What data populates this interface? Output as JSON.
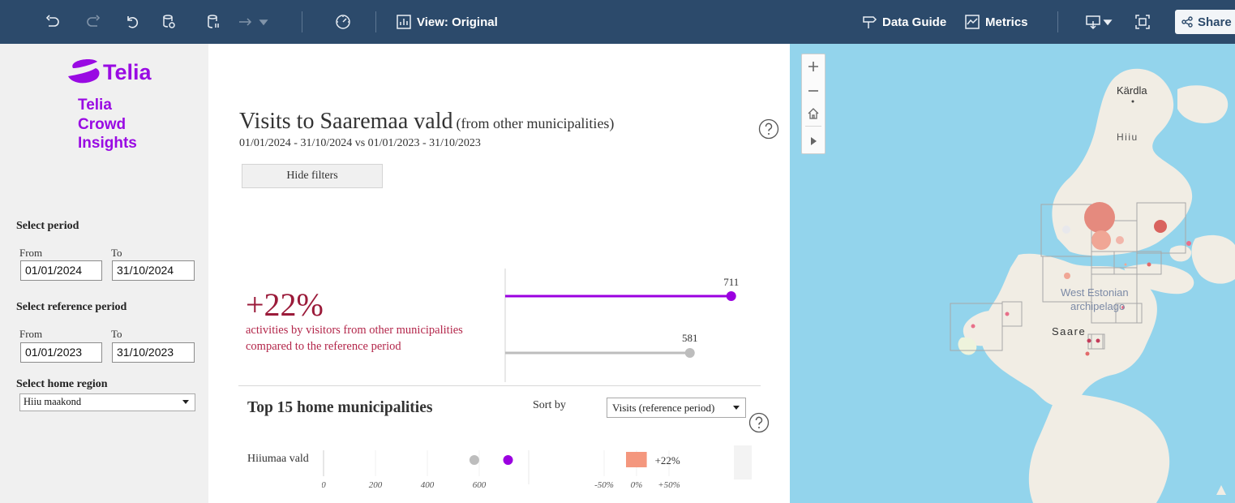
{
  "toolbar": {
    "view_label": "View: Original",
    "data_guide_label": "Data Guide",
    "metrics_label": "Metrics",
    "share_label": "Share"
  },
  "brand": {
    "name": "Telia",
    "subtitle_lines": [
      "Telia",
      "Crowd",
      "Insights"
    ],
    "color": "#990ae3"
  },
  "filters": {
    "period_heading": "Select period",
    "from_label": "From",
    "to_label": "To",
    "period_from": "01/01/2024",
    "period_to": "31/10/2024",
    "reference_heading": "Select reference period",
    "reference_from": "01/01/2023",
    "reference_to": "31/10/2023",
    "home_region_heading": "Select home region",
    "home_region_value": "Hiiu maakond"
  },
  "header": {
    "title": "Visits to Saaremaa vald",
    "title_suffix": "(from other municipalities)",
    "date_range": "01/01/2024 - 31/10/2024 vs  01/01/2023 - 31/10/2023",
    "hide_filters_label": "Hide filters"
  },
  "kpi": {
    "change_pct": "+22%",
    "description": "activities by visitors from other municipalities compared to the reference period",
    "current_value": 711,
    "reference_value": 581,
    "current_color": "#9b00e0",
    "reference_color": "#bdbdbd",
    "scale_max": 750
  },
  "top_municipalities": {
    "heading": "Top 15 home municipalities",
    "sort_label": "Sort by",
    "sort_value": "Visits (reference period)",
    "rows": [
      {
        "name": "Hiiumaa vald",
        "reference": 581,
        "current": 711,
        "change_label": "+22%",
        "change_pct": 22
      }
    ],
    "visits_ticks": [
      "0",
      "200",
      "400",
      "600"
    ],
    "visits_max": 800,
    "change_ticks": [
      "-50%",
      "0%",
      "+50%"
    ],
    "change_color": "#f4977e"
  },
  "map": {
    "labels": {
      "kardla": "Kärdla",
      "hiiu": "Hiiu",
      "archipelago_line1": "West Estonian",
      "archipelago_line2": "archipelago",
      "saare": "Saare"
    },
    "water_color": "#93d4ec",
    "land_color": "#f1ede4"
  }
}
